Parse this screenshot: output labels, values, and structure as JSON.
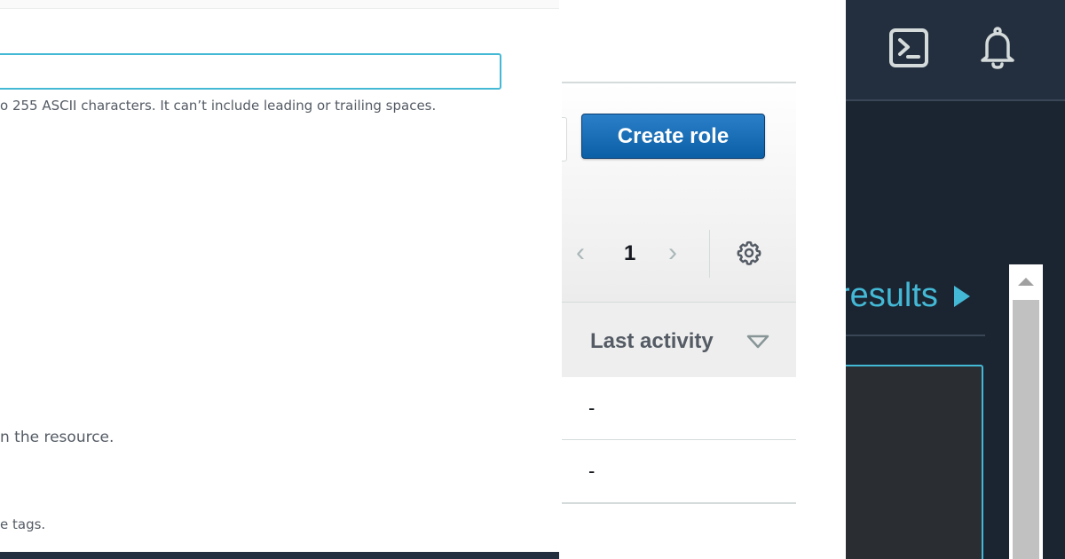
{
  "form": {
    "input_value": "",
    "helper_text": "o 255 ASCII characters. It can’t include leading or trailing spaces.",
    "resource_text": "n the resource.",
    "tags_text": "e tags."
  },
  "roles_table": {
    "create_button_label": "Create role",
    "pagination": {
      "current_page": "1",
      "prev_glyph": "‹",
      "next_glyph": "›"
    },
    "columns": [
      "Last activity"
    ],
    "rows": [
      {
        "last_activity": "-"
      },
      {
        "last_activity": "-"
      }
    ],
    "icons": {
      "settings": "gear-icon",
      "sort": "sort-descending-icon"
    }
  },
  "console": {
    "results_link": "results",
    "icons": {
      "cloudshell": "cloudshell-icon",
      "notifications": "bell-icon",
      "expand": "play-icon"
    }
  },
  "colors": {
    "accent_teal": "#44b9d6",
    "primary_button": "#0b5fa5",
    "dark_bg": "#1b2532",
    "header_bg": "#232f3e"
  }
}
